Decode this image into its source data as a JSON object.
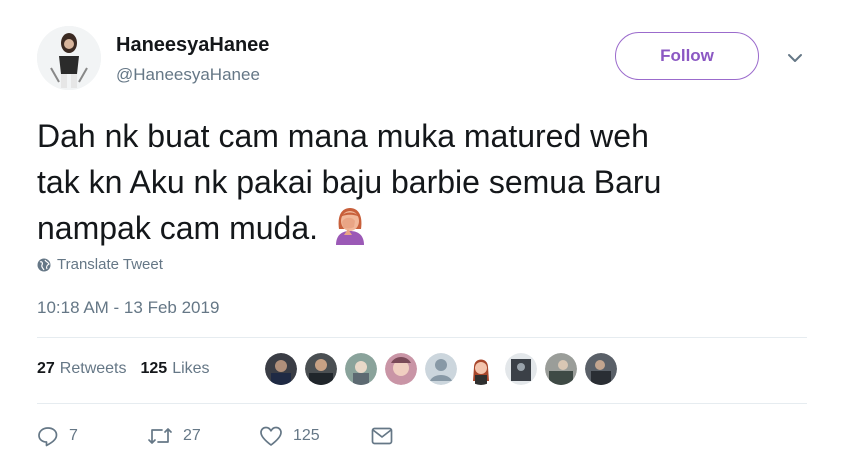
{
  "user": {
    "display_name": "HaneesyaHanee",
    "handle": "@HaneesyaHanee"
  },
  "follow_label": "Follow",
  "tweet": {
    "line1": "Dah nk buat cam mana muka matured weh",
    "line2": "tak kn Aku nk pakai baju barbie semua Baru",
    "line3": "nampak cam muda.",
    "emoji": "woman-facepalming"
  },
  "translate_label": "Translate Tweet",
  "timestamp": "10:18 AM - 13 Feb 2019",
  "stats": {
    "retweets_count": "27",
    "retweets_label": "Retweets",
    "likes_count": "125",
    "likes_label": "Likes"
  },
  "actions": {
    "replies": "7",
    "retweets": "27",
    "likes": "125"
  },
  "colors": {
    "accent": "#8b58c3",
    "muted": "#657786"
  }
}
